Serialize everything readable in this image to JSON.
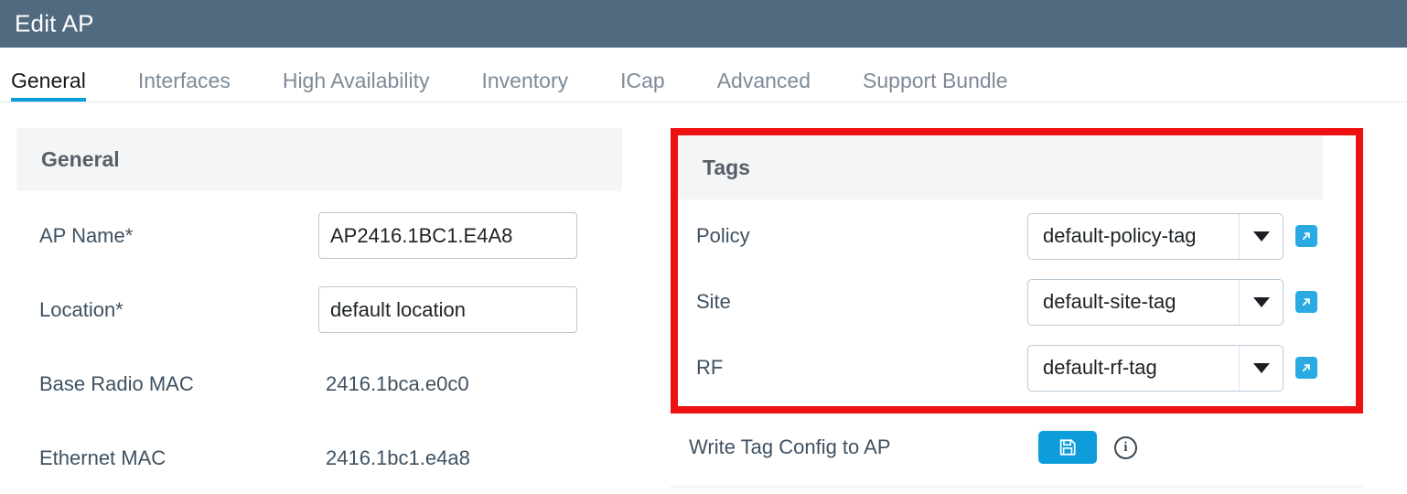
{
  "window": {
    "title": "Edit AP",
    "header_bg": "#526a80"
  },
  "tabs": [
    {
      "label": "General",
      "active": true
    },
    {
      "label": "Interfaces",
      "active": false
    },
    {
      "label": "High Availability",
      "active": false
    },
    {
      "label": "Inventory",
      "active": false
    },
    {
      "label": "ICap",
      "active": false
    },
    {
      "label": "Advanced",
      "active": false
    },
    {
      "label": "Support Bundle",
      "active": false
    }
  ],
  "accent_color": "#0d9ddb",
  "highlight_color": "#ee1111",
  "general_panel": {
    "title": "General",
    "fields": [
      {
        "label": "AP Name*",
        "value": "AP2416.1BC1.E4A8",
        "placeholder": "AP Name",
        "type": "input"
      },
      {
        "label": "Location*",
        "value": "default location",
        "placeholder": "Location",
        "type": "input"
      },
      {
        "label": "Base Radio MAC",
        "value": "2416.1bca.e0c0",
        "type": "static"
      },
      {
        "label": "Ethernet MAC",
        "value": "2416.1bc1.e4a8",
        "type": "static"
      }
    ]
  },
  "tags_panel": {
    "title": "Tags",
    "highlighted": true,
    "rows": [
      {
        "label": "Policy",
        "value": "default-policy-tag",
        "link_icon": "external-link-icon"
      },
      {
        "label": "Site",
        "value": "default-site-tag",
        "link_icon": "external-link-icon"
      },
      {
        "label": "RF",
        "value": "default-rf-tag",
        "link_icon": "external-link-icon"
      }
    ],
    "write_tag": {
      "label": "Write Tag Config to AP",
      "save_icon": "save-floppy-icon",
      "info_icon": "info-circle-icon",
      "info_char": "i"
    }
  }
}
